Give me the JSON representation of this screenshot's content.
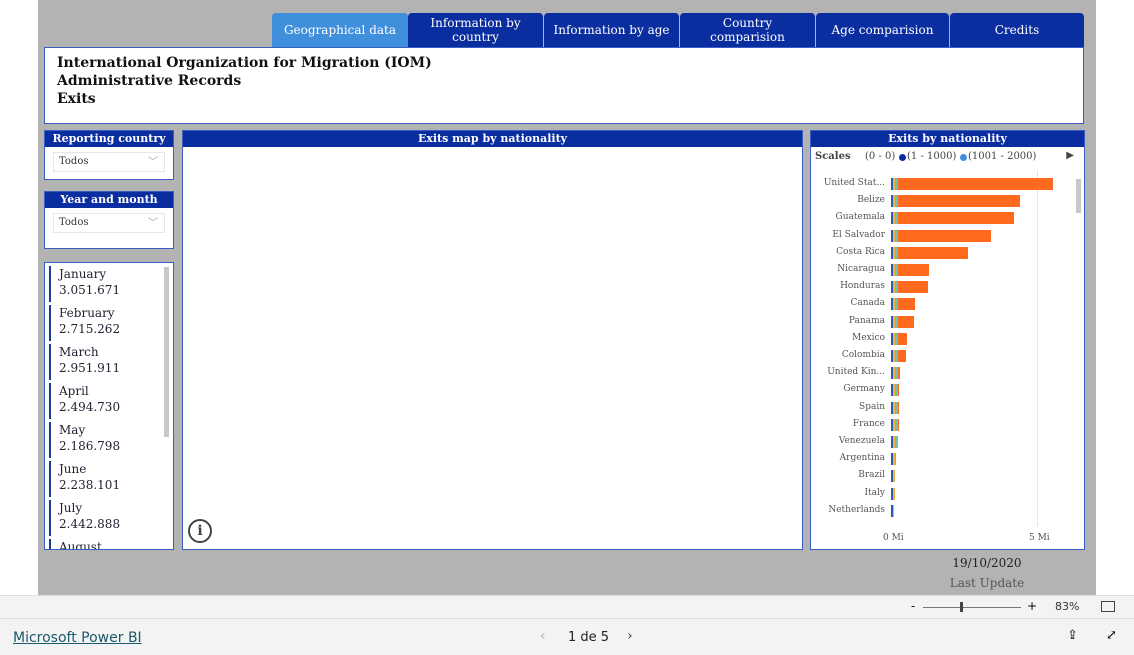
{
  "tabs": [
    {
      "label": "Geographical data",
      "active": true
    },
    {
      "label": "Information by country"
    },
    {
      "label": "Information by age"
    },
    {
      "label": "Country comparision"
    },
    {
      "label": "Age comparision"
    },
    {
      "label": "Credits"
    }
  ],
  "header": {
    "line1": "International Organization for Migration (IOM)",
    "line2": "Administrative Records",
    "line3": "Exits"
  },
  "filters": {
    "reporting_country": {
      "title": "Reporting country",
      "value": "Todos"
    },
    "year_month": {
      "title": "Year and month",
      "value": "Todos"
    }
  },
  "months": [
    {
      "name": "January",
      "value": "3.051.671"
    },
    {
      "name": "February",
      "value": "2.715.262"
    },
    {
      "name": "March",
      "value": "2.951.911"
    },
    {
      "name": "April",
      "value": "2.494.730"
    },
    {
      "name": "May",
      "value": "2.186.798"
    },
    {
      "name": "June",
      "value": "2.238.101"
    },
    {
      "name": "July",
      "value": "2.442.888"
    },
    {
      "name": "August",
      "value": ""
    }
  ],
  "map": {
    "title": "Exits map by nationality",
    "info_icon": "info-icon"
  },
  "chart_data": {
    "type": "bar",
    "orientation": "horizontal",
    "title": "Exits by nationality",
    "legend": {
      "title": "Scales",
      "entries": [
        {
          "label": "(0 - 0)",
          "color": "#ffffff"
        },
        {
          "label": "(1 - 1000)",
          "color": "#0a2ea0"
        },
        {
          "label": "(1001 - 2000)",
          "color": "#3f8fdc"
        }
      ],
      "placement": "top"
    },
    "categories": [
      "United Stat...",
      "Belize",
      "Guatemala",
      "El Salvador",
      "Costa Rica",
      "Nicaragua",
      "Honduras",
      "Canada",
      "Panama",
      "Mexico",
      "Colombia",
      "United Kin...",
      "Germany",
      "Spain",
      "France",
      "Venezuela",
      "Argentina",
      "Brazil",
      "Italy",
      "Netherlands"
    ],
    "values": [
      5.55,
      4.42,
      4.2,
      3.42,
      2.64,
      1.3,
      1.27,
      0.82,
      0.79,
      0.55,
      0.51,
      0.31,
      0.27,
      0.27,
      0.27,
      0.24,
      0.17,
      0.14,
      0.12,
      0.1
    ],
    "unit": "Mi",
    "xlim": [
      0,
      5.6
    ],
    "xticks": [
      "0 Mi",
      "5 Mi"
    ],
    "bar_color": "#ff6a1f"
  },
  "last_update": {
    "date": "19/10/2020",
    "label": "Last Update"
  },
  "zoom": {
    "minus": "-",
    "plus": "+",
    "percent": "83%",
    "level": 0.5
  },
  "footer": {
    "brand": "Microsoft Power BI",
    "page": "1 de 5"
  }
}
